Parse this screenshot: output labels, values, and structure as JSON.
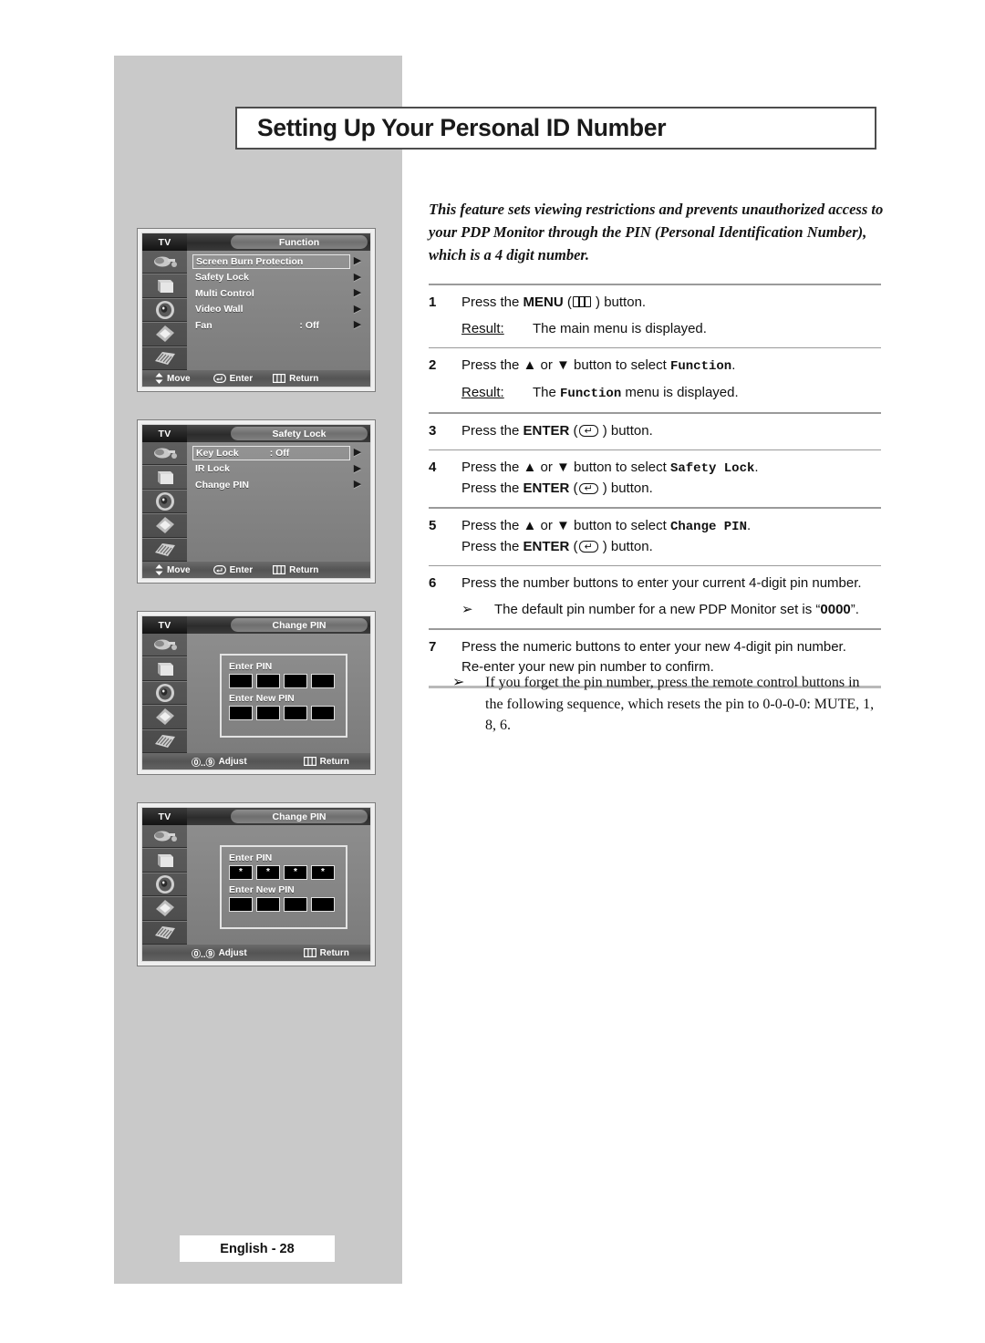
{
  "page": {
    "title": "Setting Up Your Personal ID Number",
    "intro": "This feature sets viewing restrictions and prevents unauthorized access to your PDP Monitor through the PIN (Personal Identification Number), which is a 4 digit number.",
    "footer_tag": "English - 28"
  },
  "steps": [
    {
      "num": "1",
      "line1_pre": "Press the ",
      "line1_bold": "MENU",
      "line1_post": " ) button.",
      "icon": "menu-icon",
      "result_label": "Result:",
      "result_text": "The main menu is displayed."
    },
    {
      "num": "2",
      "line1_pre": "Press the ▲ or ▼ button to select ",
      "line1_mono": "Function",
      "line1_post": ".",
      "result_label": "Result:",
      "result_pre": "The ",
      "result_mono": "Function",
      "result_post": " menu is displayed."
    },
    {
      "num": "3",
      "line1_pre": "Press the ",
      "line1_bold": "ENTER",
      "line1_post": " ) button.",
      "icon": "enter-icon"
    },
    {
      "num": "4",
      "line1_pre": "Press the ▲ or ▼ button to select ",
      "line1_mono": "Safety Lock",
      "line1_post": ".",
      "line2_pre": "Press the ",
      "line2_bold": "ENTER",
      "line2_post": " ) button.",
      "icon": "enter-icon"
    },
    {
      "num": "5",
      "line1_pre": "Press the ▲ or ▼ button to select ",
      "line1_mono": "Change PIN",
      "line1_post": ".",
      "line2_pre": "Press the ",
      "line2_bold": "ENTER",
      "line2_post": " ) button.",
      "icon": "enter-icon"
    },
    {
      "num": "6",
      "line1_plain": "Press the number buttons to enter your current 4-digit pin number.",
      "note_arrow": "➢",
      "note_pre": "The default pin number for a new PDP Monitor set is “",
      "note_bold": "0000",
      "note_post": "”."
    },
    {
      "num": "7",
      "line1_plain": "Press the numeric buttons to enter your new 4-digit pin number.",
      "line2_plain": "Re-enter your new pin number to confirm."
    }
  ],
  "final_note": {
    "arrow": "➢",
    "text": "If you forget the pin number, press the remote control buttons in the following sequence, which resets the pin to 0-0-0-0: MUTE, 1, 8, 6."
  },
  "osd_common": {
    "tv_label": "TV",
    "move_label": "Move",
    "enter_label": "Enter",
    "return_label": "Return",
    "adjust_label": "Adjust",
    "adjust_range": "⓪..⑨",
    "rail_icons": [
      "input-source-icon",
      "picture-monitor-icon",
      "sound-speaker-icon",
      "setup-chip-icon",
      "function-cards-icon"
    ]
  },
  "osd_panels": [
    {
      "name": "function-menu",
      "title": "Function",
      "rows": [
        {
          "label": "Screen Burn Protection",
          "value": "",
          "arrow": "▶",
          "selected": true
        },
        {
          "label": "Safety Lock",
          "value": "",
          "arrow": "▶",
          "selected": false
        },
        {
          "label": "Multi Control",
          "value": "",
          "arrow": "▶",
          "selected": false
        },
        {
          "label": "Video Wall",
          "value": "",
          "arrow": "▶",
          "selected": false
        },
        {
          "label": "Fan",
          "value": ": Off",
          "arrow": "▶",
          "selected": false
        }
      ]
    },
    {
      "name": "safety-lock-menu",
      "title": "Safety Lock",
      "rows": [
        {
          "label": "Key Lock",
          "value": ": Off",
          "arrow": "▶",
          "selected": true
        },
        {
          "label": "IR Lock",
          "value": "",
          "arrow": "▶",
          "selected": false
        },
        {
          "label": "Change PIN",
          "value": "",
          "arrow": "▶",
          "selected": false
        }
      ]
    },
    {
      "name": "change-pin-empty",
      "title": "Change PIN",
      "pin": {
        "enter_label": "Enter PIN",
        "enter_digits": [
          "",
          "",
          "",
          ""
        ],
        "new_label": "Enter New PIN",
        "new_digits": [
          "",
          "",
          "",
          ""
        ]
      }
    },
    {
      "name": "change-pin-filled",
      "title": "Change PIN",
      "pin": {
        "enter_label": "Enter PIN",
        "enter_digits": [
          "*",
          "*",
          "*",
          "*"
        ],
        "new_label": "Enter New PIN",
        "new_digits": [
          "",
          "",
          "",
          ""
        ]
      }
    }
  ],
  "colors": {
    "page_background": "#ffffff",
    "sidebar_gray": "#c9c9c9",
    "title_border": "#4d4d4d",
    "osd_body": "#8a8a8a",
    "text": "#111111"
  }
}
